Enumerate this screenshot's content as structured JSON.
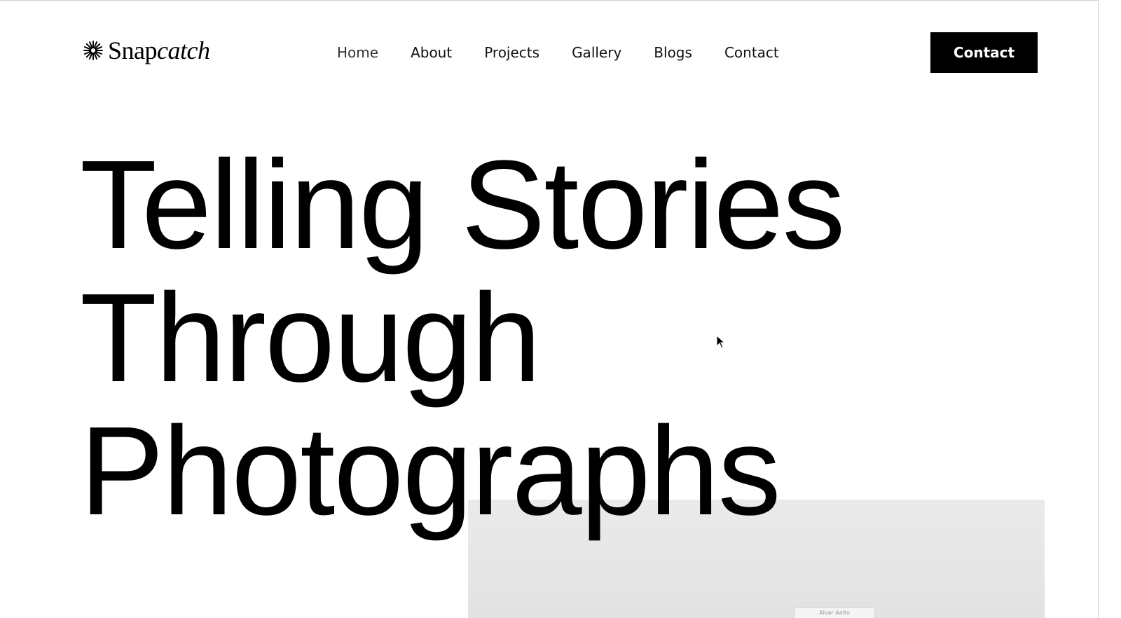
{
  "brand": {
    "name_regular": "Snap",
    "name_italic": "catch",
    "logo_icon": "starburst-icon"
  },
  "nav": {
    "items": [
      {
        "label": "Home",
        "active": true
      },
      {
        "label": "About"
      },
      {
        "label": "Projects"
      },
      {
        "label": "Gallery"
      },
      {
        "label": "Blogs"
      },
      {
        "label": "Contact"
      }
    ],
    "cta_label": "Contact"
  },
  "hero": {
    "title_lines": [
      "Telling Stories",
      "Through",
      "Photographs"
    ],
    "photo_tag": "Alvar Aalto"
  },
  "colors": {
    "background": "#ffffff",
    "text": "#000000",
    "cta_bg": "#000000",
    "cta_text": "#ffffff"
  }
}
